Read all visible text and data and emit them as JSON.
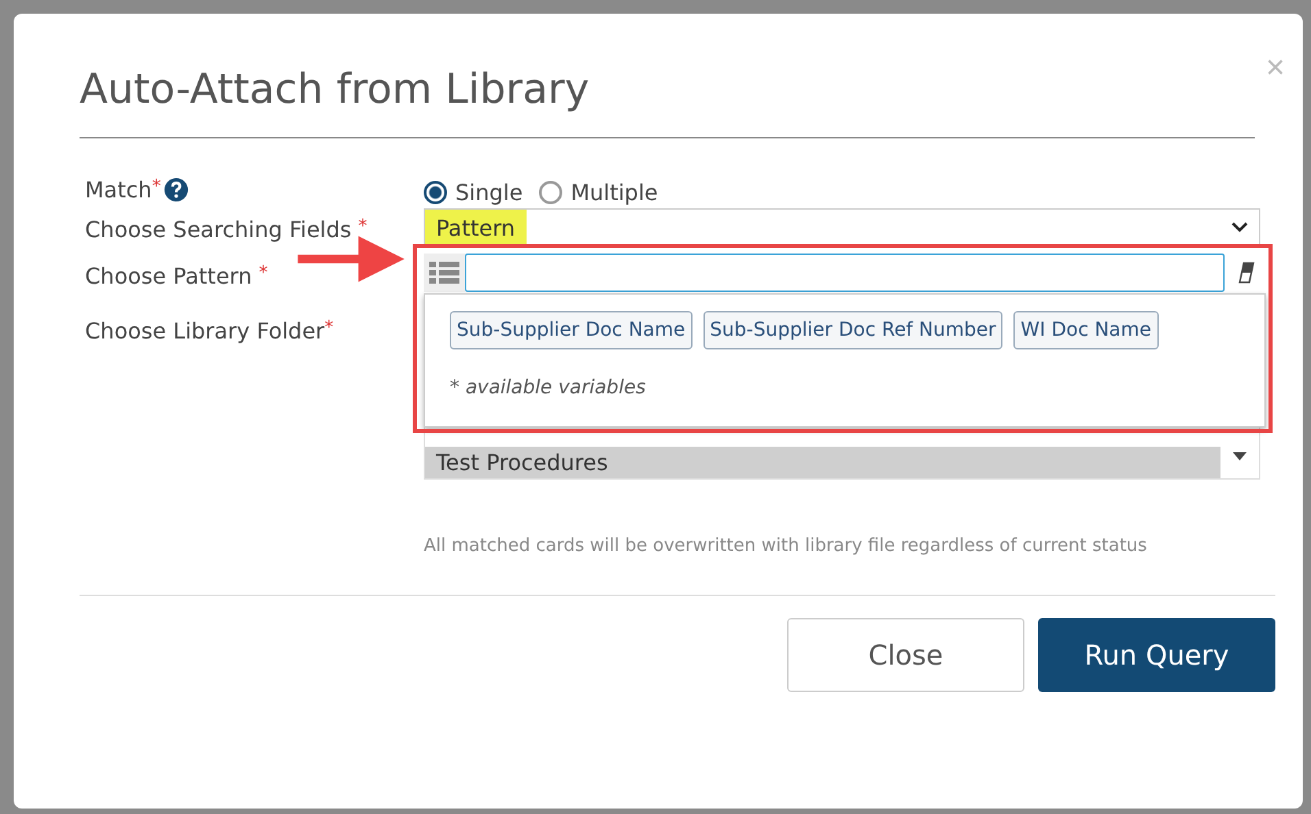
{
  "dialog": {
    "title": "Auto-Attach from Library",
    "close": "×"
  },
  "form": {
    "match": {
      "label": "Match",
      "required": "*",
      "options": [
        {
          "label": "Single",
          "selected": true
        },
        {
          "label": "Multiple",
          "selected": false
        }
      ]
    },
    "searching_fields": {
      "label": "Choose Searching Fields",
      "required": "*",
      "value": "Pattern",
      "highlighted": true
    },
    "pattern": {
      "label": "Choose Pattern",
      "required": "*",
      "variables": [
        "Sub-Supplier Doc Name",
        "Sub-Supplier Doc Ref Number",
        "WI Doc Name"
      ],
      "variables_note": "* available variables"
    },
    "library_folder": {
      "label": "Choose Library Folder",
      "required": "*",
      "items": [
        {
          "label": "Test Procedures",
          "selected": true
        }
      ]
    }
  },
  "note": "All matched cards will be overwritten with library file regardless of current status",
  "buttons": [
    {
      "label": "Close",
      "kind": "secondary"
    },
    {
      "label": "Run Query",
      "kind": "primary"
    }
  ]
}
